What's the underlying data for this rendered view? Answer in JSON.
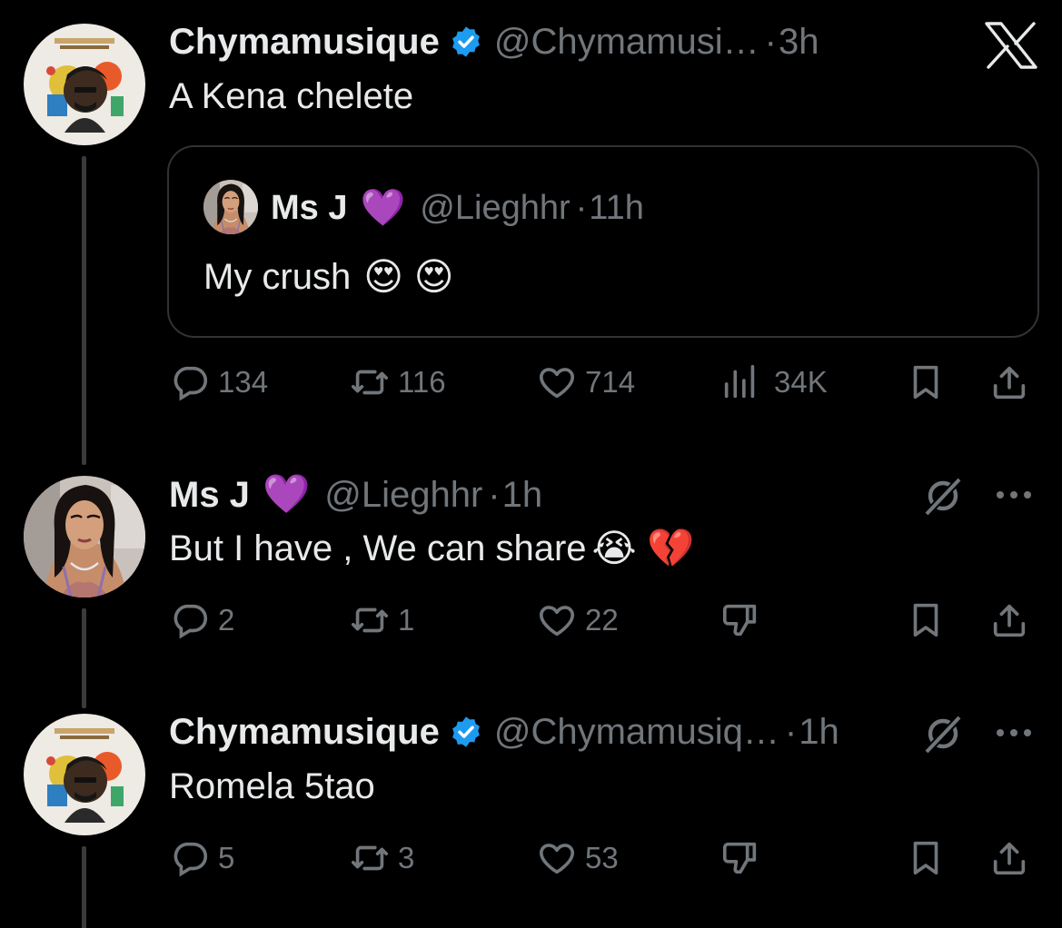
{
  "app": {
    "logo_icon": "x-logo-icon"
  },
  "tweets": [
    {
      "name": "Chymamusique",
      "verified": true,
      "handle": "@Chymamusi…",
      "time": "3h",
      "text": "A Kena chelete",
      "quote": {
        "name": "Ms J",
        "name_emoji": "💜",
        "handle": "@Lieghhr",
        "time": "11h",
        "text": "My crush",
        "text_emoji": "😍 😍"
      },
      "actions": {
        "replies": "134",
        "reposts": "116",
        "likes": "714",
        "views": "34K"
      }
    },
    {
      "name": "Ms J",
      "name_emoji": "💜",
      "handle": "@Lieghhr",
      "time": "1h",
      "text": "But I have , We can share",
      "text_emoji": "😭 💔",
      "actions": {
        "replies": "2",
        "reposts": "1",
        "likes": "22"
      }
    },
    {
      "name": "Chymamusique",
      "verified": true,
      "handle": "@Chymamusiq…",
      "time": "1h",
      "text": "Romela 5tao",
      "actions": {
        "replies": "5",
        "reposts": "3",
        "likes": "53"
      }
    }
  ],
  "colors": {
    "background": "#000000",
    "text": "#e7e9ea",
    "muted": "#71767b",
    "verified": "#1d9bf0",
    "border": "#2f3336"
  }
}
